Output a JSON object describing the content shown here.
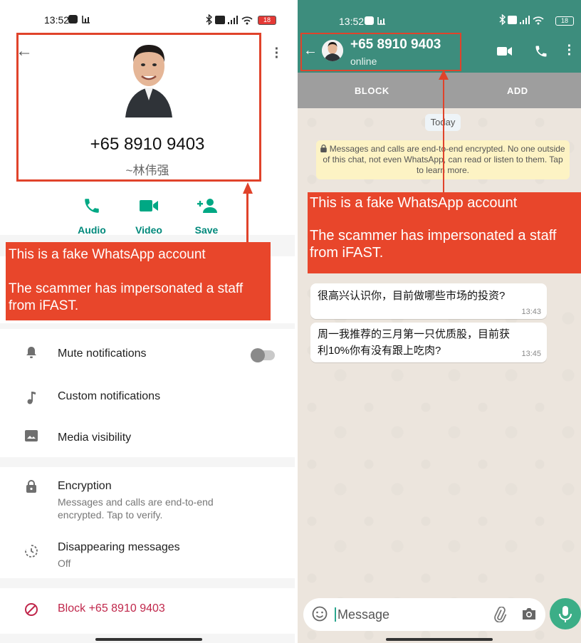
{
  "left": {
    "status": {
      "time": "13:52",
      "battery": "18"
    },
    "contact": {
      "phone": "+65 8910 9403",
      "nickname": "~林伟强"
    },
    "actions": [
      {
        "label": "Audio"
      },
      {
        "label": "Video"
      },
      {
        "label": "Save"
      }
    ],
    "annotation": {
      "line1": "This is a fake WhatsApp account",
      "line2": "The scammer has impersonated a staff from iFAST."
    },
    "settings": {
      "mute": "Mute notifications",
      "custom": "Custom notifications",
      "media": "Media visibility",
      "encryption_title": "Encryption",
      "encryption_sub": "Messages and calls are end-to-end encrypted. Tap to verify.",
      "disappearing_title": "Disappearing messages",
      "disappearing_sub": "Off",
      "block": "Block +65 8910 9403"
    }
  },
  "right": {
    "status": {
      "time": "13:52",
      "battery": "18"
    },
    "header": {
      "name": "+65 8910 9403",
      "status": "online"
    },
    "bar": {
      "block": "BLOCK",
      "add": "ADD"
    },
    "today": "Today",
    "encryption_notice": "Messages and calls are end-to-end encrypted. No one outside of this chat, not even WhatsApp, can read or listen to them. Tap to learn more.",
    "annotation": {
      "line1": "This is a fake WhatsApp account",
      "line2": "The scammer has impersonated a staff from iFAST."
    },
    "messages": [
      {
        "text": "很高兴认识你，目前做哪些市场的投资?",
        "time": "13:43"
      },
      {
        "text_line1": "周一我推荐的三月第一只优质股，目前获",
        "text_line2": "利10%你有没有跟上吃肉?",
        "time": "13:45"
      }
    ],
    "input": {
      "placeholder": "Message"
    }
  },
  "colors": {
    "annotation_red": "#e8462b",
    "whatsapp_teal": "#3d8d7d",
    "action_teal": "#00897b",
    "block_red": "#c0274b",
    "mic_green": "#3cae87"
  }
}
